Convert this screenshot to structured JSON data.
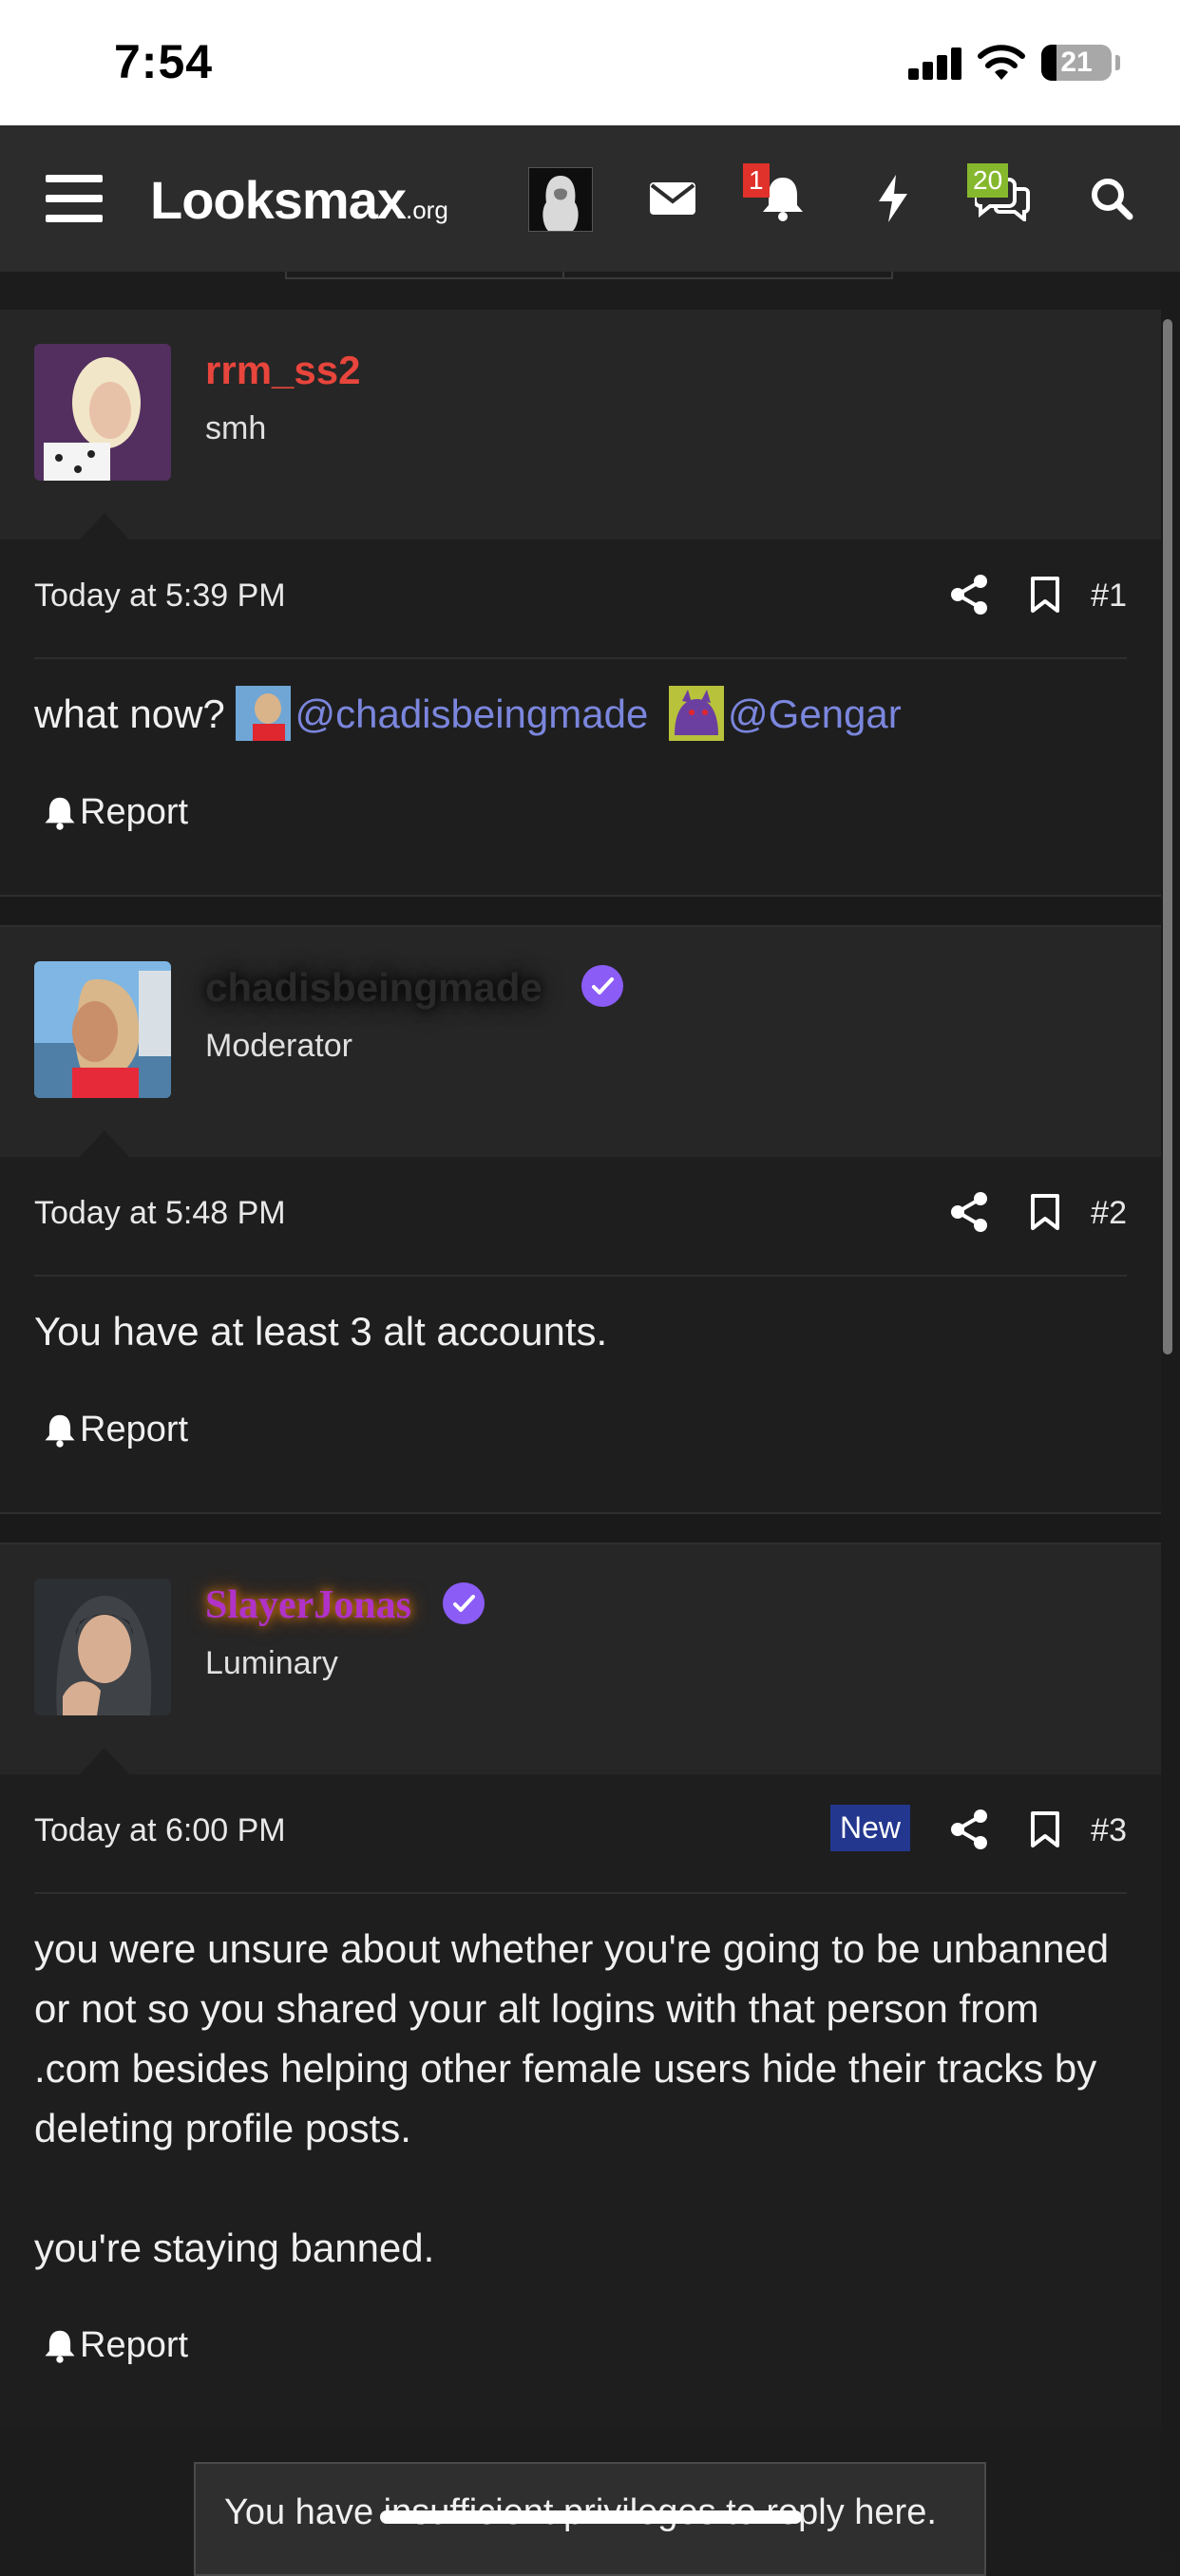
{
  "status_bar": {
    "time": "7:54",
    "battery": "21"
  },
  "navbar": {
    "logo_main": "Looksmax",
    "logo_suffix": ".org",
    "alerts_count": "1",
    "conversations_count": "20"
  },
  "posts": [
    {
      "username": "rrm_ss2",
      "username_color": "#e8453c",
      "role": "smh",
      "timestamp": "Today at 5:39 PM",
      "number": "#1",
      "message_prefix": "what now? ",
      "mentions": [
        "@chadisbeingmade",
        "@Gengar"
      ],
      "report_label": "Report"
    },
    {
      "username": "chadisbeingmade",
      "role": "Moderator",
      "timestamp": "Today at 5:48 PM",
      "number": "#2",
      "message": "You have at least 3 alt accounts.",
      "report_label": "Report"
    },
    {
      "username": "SlayerJonas",
      "role": "Luminary",
      "timestamp": "Today at 6:00 PM",
      "new_badge": "New",
      "number": "#3",
      "message_paragraph_1": "you were unsure about whether you're going to be unbanned or not so you shared your alt logins with that person from .com besides helping other female users hide their tracks by deleting profile posts.",
      "message_paragraph_2": "you're staying banned.",
      "report_label": "Report"
    }
  ],
  "reply_notice": "You have insufficient privileges to reply here.",
  "colors": {
    "mention": "#7b86dd",
    "verified": "#8b5cf6",
    "new_badge": "#23378f",
    "alert_badge": "#e0312b",
    "conversation_badge": "#86b82e"
  },
  "icons": [
    "menu-icon",
    "envelope-icon",
    "bell-icon",
    "bolt-icon",
    "chat-bubbles-icon",
    "search-icon",
    "share-icon",
    "bookmark-icon",
    "verified-check-icon"
  ]
}
